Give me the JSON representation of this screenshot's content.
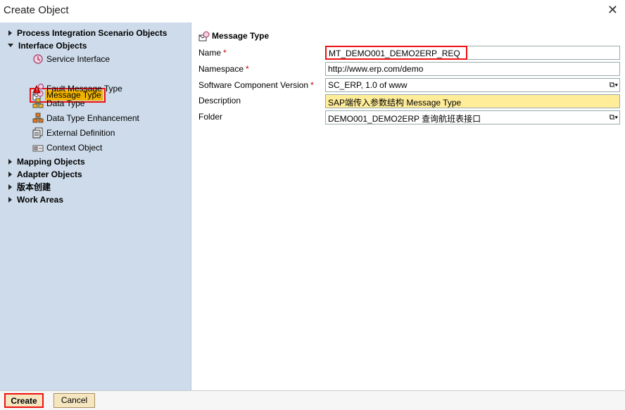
{
  "window": {
    "title": "Create Object",
    "close_glyph": "✕"
  },
  "sidebar": {
    "items": [
      {
        "label": "Process Integration Scenario Objects",
        "type": "category",
        "expanded": false
      },
      {
        "label": "Interface Objects",
        "type": "category",
        "expanded": true
      },
      {
        "label": "Service Interface",
        "type": "child",
        "icon": "service-interface-icon"
      },
      {
        "label": "Message Type",
        "type": "child",
        "icon": "message-type-icon",
        "selected": true
      },
      {
        "label": "Fault Message Type",
        "type": "child",
        "icon": "fault-message-type-icon"
      },
      {
        "label": "Data Type",
        "type": "child",
        "icon": "data-type-icon"
      },
      {
        "label": "Data Type Enhancement",
        "type": "child",
        "icon": "data-type-enhancement-icon"
      },
      {
        "label": "External Definition",
        "type": "child",
        "icon": "external-definition-icon"
      },
      {
        "label": "Context Object",
        "type": "child",
        "icon": "context-object-icon"
      },
      {
        "label": "Mapping Objects",
        "type": "category",
        "expanded": false
      },
      {
        "label": "Adapter Objects",
        "type": "category",
        "expanded": false
      },
      {
        "label": "版本创建",
        "type": "category",
        "expanded": false
      },
      {
        "label": "Work Areas",
        "type": "category",
        "expanded": false
      }
    ]
  },
  "form": {
    "header": "Message Type",
    "name": {
      "label": "Name",
      "required_mark": "*",
      "value": "MT_DEMO001_DEMO2ERP_REQ"
    },
    "namespace": {
      "label": "Namespace",
      "required_mark": "*",
      "value": "http://www.erp.com/demo"
    },
    "swcv": {
      "label": "Software Component Version",
      "required_mark": "*",
      "value": "SC_ERP, 1.0 of www"
    },
    "description": {
      "label": "Description",
      "value": "SAP端传入参数结构 Message Type"
    },
    "folder": {
      "label": "Folder",
      "value": "DEMO001_DEMO2ERP 查询航班表接口"
    }
  },
  "footer": {
    "create_label": "Create",
    "cancel_label": "Cancel"
  },
  "colors": {
    "sidebar_bg": "#cddbea",
    "highlight": "#e11111",
    "selected_bg": "#f0b400",
    "description_bg": "#ffed9a",
    "button_bg": "#f6e6c0"
  }
}
